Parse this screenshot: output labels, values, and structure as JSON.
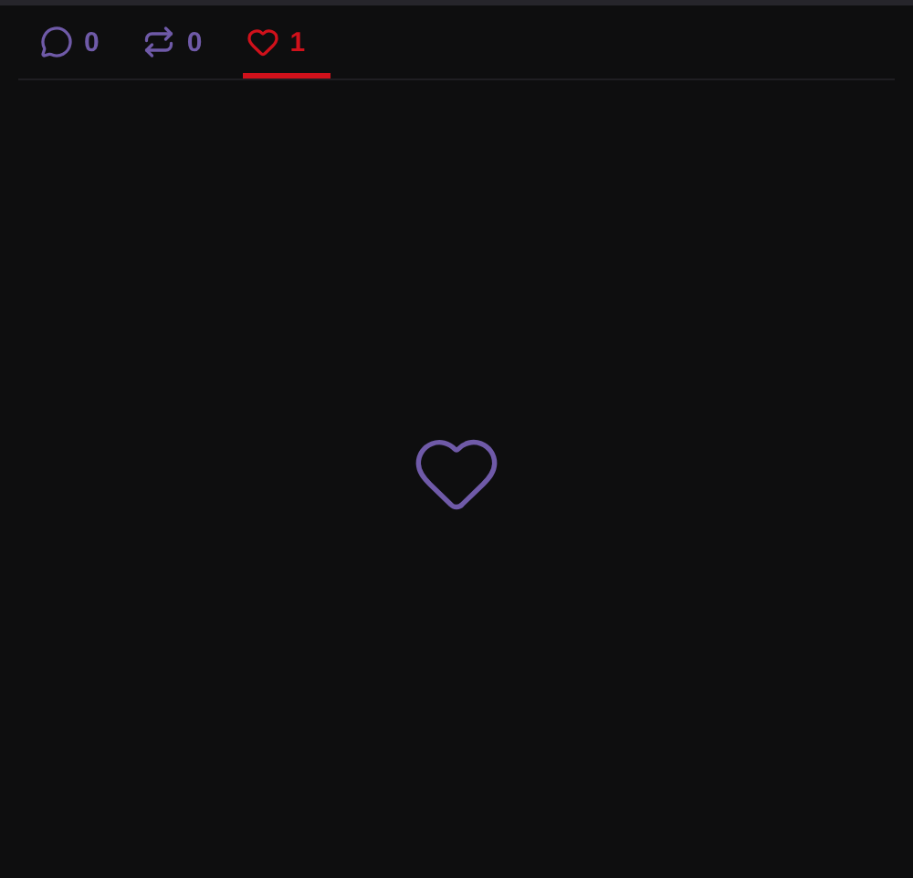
{
  "tabs": [
    {
      "kind": "comment",
      "count": "0",
      "selected": false
    },
    {
      "kind": "repost",
      "count": "0",
      "selected": false
    },
    {
      "kind": "like",
      "count": "1",
      "selected": true
    }
  ],
  "empty_state": {
    "kind": "like"
  }
}
